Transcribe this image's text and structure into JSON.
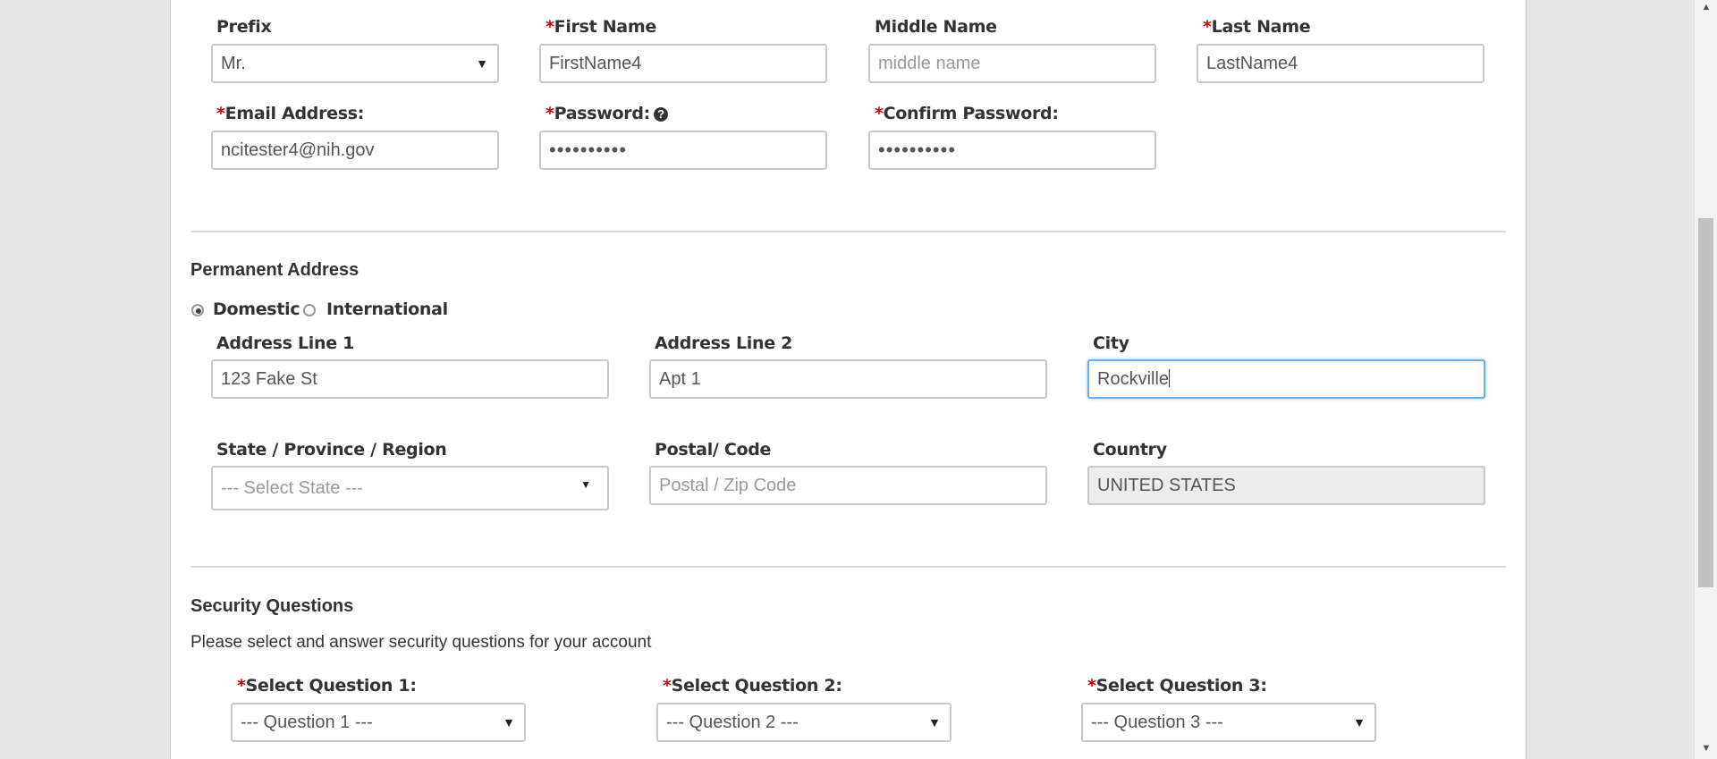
{
  "personal": {
    "prefix_label": "Prefix",
    "prefix_value": "Mr.",
    "first_name_label": "First Name",
    "first_name_value": "FirstName4",
    "middle_name_label": "Middle Name",
    "middle_name_placeholder": "middle name",
    "last_name_label": "Last Name",
    "last_name_value": "LastName4",
    "email_label": "Email Address:",
    "email_value": "ncitester4@nih.gov",
    "password_label": "Password:",
    "password_value": "••••••••••",
    "confirm_password_label": "Confirm Password:",
    "confirm_password_value": "••••••••••",
    "required_marker": "*",
    "help_icon_glyph": "?"
  },
  "address": {
    "section_title": "Permanent Address",
    "radio_domestic": "Domestic",
    "radio_international": "International",
    "selected": "Domestic",
    "line1_label": "Address Line 1",
    "line1_value": "123 Fake St",
    "line2_label": "Address Line 2",
    "line2_value": "Apt 1",
    "city_label": "City",
    "city_value": "Rockville",
    "state_label": "State / Province / Region",
    "state_value": "--- Select State ---",
    "postal_label": "Postal/ Code",
    "postal_placeholder": "Postal / Zip Code",
    "country_label": "Country",
    "country_value": "UNITED STATES"
  },
  "security": {
    "section_title": "Security Questions",
    "description": "Please select and answer security questions for your account",
    "q1_label": "Select Question 1:",
    "q1_value": "--- Question 1 ---",
    "q2_label": "Select Question 2:",
    "q2_value": "--- Question 2 ---",
    "q3_label": "Select Question 3:",
    "q3_value": "--- Question 3 ---"
  },
  "icons": {
    "select_caret": "▼",
    "scroll_up": "▲",
    "scroll_down": "▼"
  },
  "colors": {
    "required": "#cc0000",
    "focus_border": "#66afe9"
  }
}
